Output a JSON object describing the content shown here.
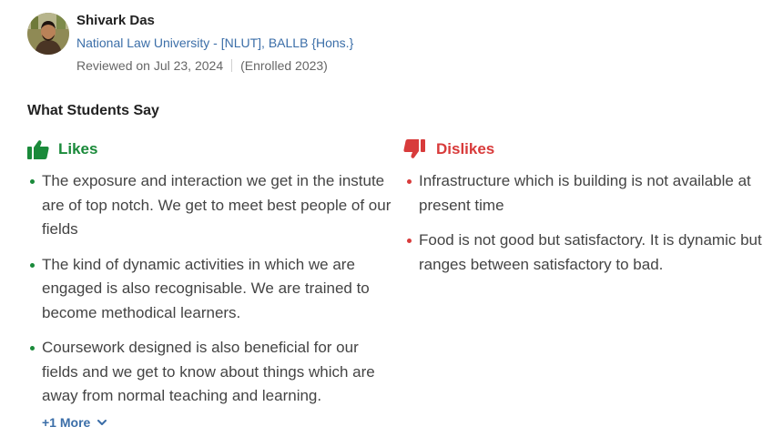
{
  "reviewer": {
    "name": "Shivark Das",
    "course_link": "National Law University - [NLUT], BALLB {Hons.}",
    "reviewed_on": "Reviewed on Jul 23, 2024",
    "enrolled": "(Enrolled 2023)",
    "avatar_icon": "profile-photo"
  },
  "section": {
    "title": "What Students Say"
  },
  "likes": {
    "heading": "Likes",
    "icon": "thumbs-up-icon",
    "color": "#1a8a3a",
    "items": [
      "The exposure and interaction we get in the instute are of top notch. We get to meet best people of our fields",
      "The kind of dynamic activities in which we are engaged is also recognisable. We are trained to become methodical learners.",
      "Coursework designed is also beneficial for our fields and we get to know about things which are away from normal teaching and learning."
    ],
    "more_label": "+1 More"
  },
  "dislikes": {
    "heading": "Dislikes",
    "icon": "thumbs-down-icon",
    "color": "#d83b3b",
    "items": [
      "Infrastructure which is building is not available at present time",
      "Food is not good but satisfactory. It is dynamic but ranges between satisfactory to bad."
    ]
  },
  "link_color": "#3b6ea8"
}
